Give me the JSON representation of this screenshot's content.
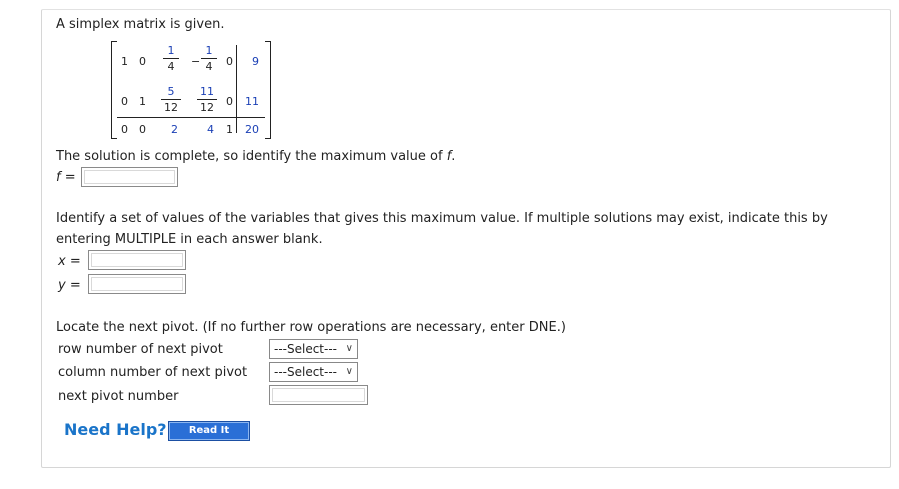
{
  "intro": "A simplex matrix is given.",
  "matrix": {
    "row1": {
      "c1": "1",
      "c2": "0",
      "c3_num": "1",
      "c3_den": "4",
      "c4_sign": "−",
      "c4_num": "1",
      "c4_den": "4",
      "c5": "0",
      "c6": "9"
    },
    "row2": {
      "c1": "0",
      "c2": "1",
      "c3_num": "5",
      "c3_den": "12",
      "c4_num": "11",
      "c4_den": "12",
      "c5": "0",
      "c6": "11"
    },
    "row3": {
      "c1": "0",
      "c2": "0",
      "c3": "2",
      "c4": "4",
      "c5": "1",
      "c6": "20"
    }
  },
  "solution_text": "The solution is complete, so identify the maximum value of",
  "f_var": "f",
  "f_label": "f =",
  "f_value": "",
  "vars_text_line1": "Identify a set of values of the variables that gives this maximum value. If multiple solutions may exist, indicate this by",
  "vars_text_line2": "entering MULTIPLE in each answer blank.",
  "x_label": "x =",
  "x_value": "",
  "y_label": "y =",
  "y_value": "",
  "pivot_text": "Locate the next pivot. (If no further row operations are necessary, enter DNE.)",
  "row_pivot_label": "row number of next pivot",
  "row_pivot_select": "---Select---",
  "col_pivot_label": "column number of next pivot",
  "col_pivot_select": "---Select---",
  "next_pivot_label": "next pivot number",
  "next_pivot_value": "",
  "need_help": "Need Help?",
  "read_it": "Read It",
  "icons": {
    "dropdown": "chevron-down-icon"
  }
}
